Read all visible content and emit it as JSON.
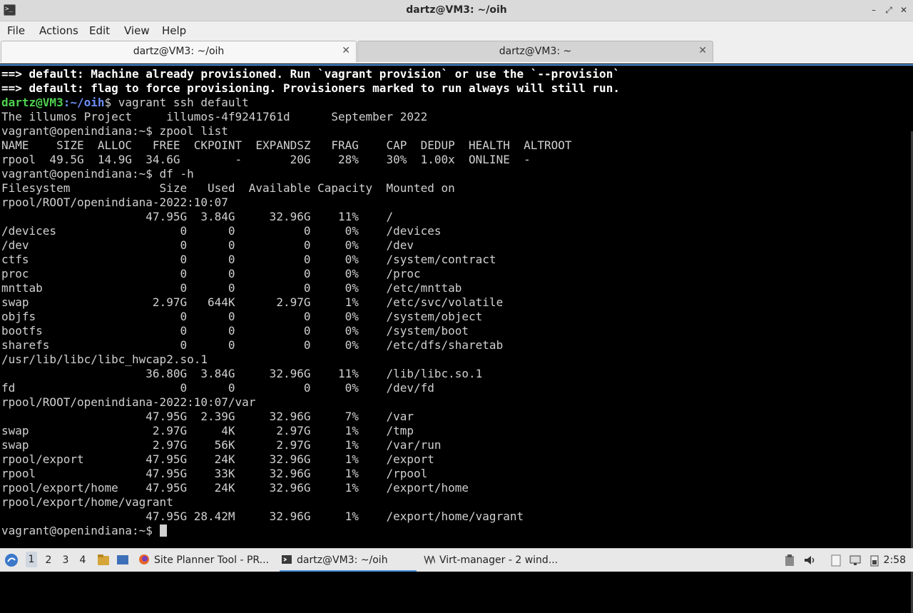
{
  "window": {
    "title": "dartz@VM3: ~/oih",
    "app_icon_text": ">_"
  },
  "window_controls": {
    "minimize": "–",
    "maximize": "⤢",
    "close": "✕"
  },
  "menu": [
    "File",
    "Actions",
    "Edit",
    "View",
    "Help"
  ],
  "tabs": [
    {
      "label": "dartz@VM3: ~/oih",
      "close": "✕",
      "active": true
    },
    {
      "label": "dartz@VM3: ~",
      "close": "✕",
      "active": false
    }
  ],
  "terminal": {
    "banner": [
      "==> default: Machine already provisioned. Run `vagrant provision` or use the `--provision`",
      "==> default: flag to force provisioning. Provisioners marked to run always will still run."
    ],
    "prompt": {
      "user_host": "dartz@VM3",
      "path": ":~/oih",
      "dollar": "$",
      "command": " vagrant ssh default"
    },
    "lines": [
      "The illumos Project     illumos-4f9241761d      September 2022",
      "vagrant@openindiana:~$ zpool list",
      "NAME    SIZE  ALLOC   FREE  CKPOINT  EXPANDSZ   FRAG    CAP  DEDUP  HEALTH  ALTROOT",
      "rpool  49.5G  14.9G  34.6G        -       20G    28%    30%  1.00x  ONLINE  -",
      "vagrant@openindiana:~$ df -h",
      "Filesystem             Size   Used  Available Capacity  Mounted on",
      "rpool/ROOT/openindiana-2022:10:07",
      "                     47.95G  3.84G     32.96G    11%    /",
      "/devices                  0      0          0     0%    /devices",
      "/dev                      0      0          0     0%    /dev",
      "ctfs                      0      0          0     0%    /system/contract",
      "proc                      0      0          0     0%    /proc",
      "mnttab                    0      0          0     0%    /etc/mnttab",
      "swap                  2.97G   644K      2.97G     1%    /etc/svc/volatile",
      "objfs                     0      0          0     0%    /system/object",
      "bootfs                    0      0          0     0%    /system/boot",
      "sharefs                   0      0          0     0%    /etc/dfs/sharetab",
      "/usr/lib/libc/libc_hwcap2.so.1",
      "                     36.80G  3.84G     32.96G    11%    /lib/libc.so.1",
      "fd                        0      0          0     0%    /dev/fd",
      "rpool/ROOT/openindiana-2022:10:07/var",
      "                     47.95G  2.39G     32.96G     7%    /var",
      "swap                  2.97G     4K      2.97G     1%    /tmp",
      "swap                  2.97G    56K      2.97G     1%    /var/run",
      "rpool/export         47.95G    24K     32.96G     1%    /export",
      "rpool                47.95G    33K     32.96G     1%    /rpool",
      "rpool/export/home    47.95G    24K     32.96G     1%    /export/home",
      "rpool/export/home/vagrant",
      "                     47.95G 28.42M     32.96G     1%    /export/home/vagrant"
    ],
    "final_prompt": "vagrant@openindiana:~$ "
  },
  "taskbar": {
    "workspaces": [
      "1",
      "2",
      "3",
      "4"
    ],
    "active_workspace": "1",
    "tasks": [
      {
        "label": "Site Planner Tool - PR..."
      },
      {
        "label": "dartz@VM3: ~/oih"
      },
      {
        "label": "Virt-manager - 2 wind..."
      }
    ],
    "clock": "2:58"
  }
}
